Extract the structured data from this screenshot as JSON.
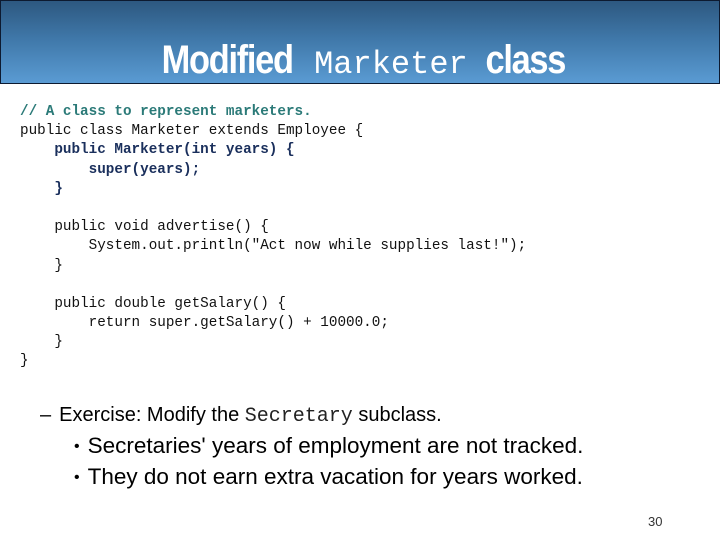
{
  "slide": {
    "title": {
      "prefix": "Modified",
      "code": "Marketer",
      "suffix": "class"
    },
    "code_lines": [
      {
        "text": "// A class to represent marketers.",
        "style": "comment"
      },
      {
        "text": "public class Marketer extends Employee {",
        "style": "plain"
      },
      {
        "text": "    public Marketer(int years) {",
        "style": "ctor"
      },
      {
        "text": "        super(years);",
        "style": "ctor"
      },
      {
        "text": "    }",
        "style": "ctor"
      },
      {
        "text": "",
        "style": "plain"
      },
      {
        "text": "    public void advertise() {",
        "style": "plain"
      },
      {
        "text": "        System.out.println(\"Act now while supplies last!\");",
        "style": "plain"
      },
      {
        "text": "    }",
        "style": "plain"
      },
      {
        "text": "",
        "style": "plain"
      },
      {
        "text": "    public double getSalary() {",
        "style": "plain"
      },
      {
        "text": "        return super.getSalary() + 10000.0;",
        "style": "plain"
      },
      {
        "text": "    }",
        "style": "plain"
      },
      {
        "text": "}",
        "style": "plain"
      }
    ],
    "exercise": {
      "dash": "–",
      "prefix": "Exercise: Modify the",
      "code": "Secretary",
      "suffix": "subclass."
    },
    "bullets": [
      "Secretaries' years of employment are not tracked.",
      "They do not earn extra vacation for years worked."
    ],
    "bullet_glyph": "•",
    "page_number": "30"
  },
  "colors": {
    "header_top": "#2d5880",
    "header_bottom": "#5a9bd3",
    "header_border": "#0d1a30",
    "comment": "#2b7a78",
    "constructor": "#1a2f5c"
  }
}
